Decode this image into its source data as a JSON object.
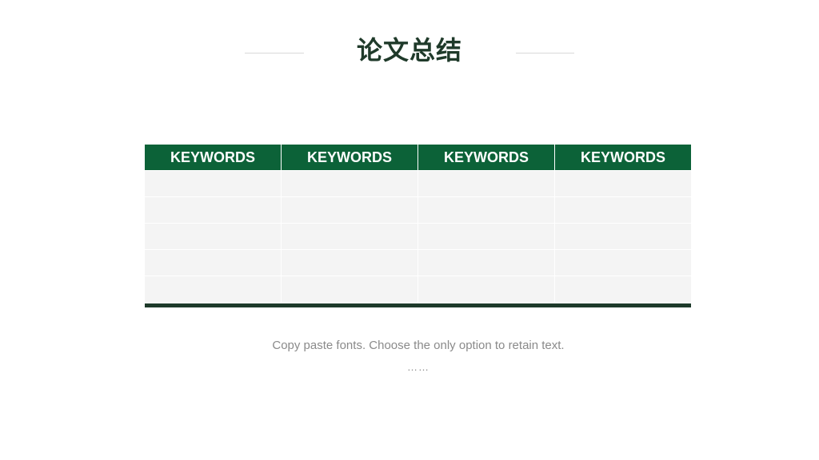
{
  "title": "论文总结",
  "table": {
    "headers": [
      "KEYWORDS",
      "KEYWORDS",
      "KEYWORDS",
      "KEYWORDS"
    ],
    "rows": [
      [
        "",
        "",
        "",
        ""
      ],
      [
        "",
        "",
        "",
        ""
      ],
      [
        "",
        "",
        "",
        ""
      ],
      [
        "",
        "",
        "",
        ""
      ],
      [
        "",
        "",
        "",
        ""
      ]
    ]
  },
  "caption": "Copy paste fonts. Choose the only option to retain text.",
  "ellipsis": "……",
  "colors": {
    "header_bg": "#0c6238",
    "bottom_bar": "#1e3a2a",
    "row_bg": "#f4f4f4",
    "title": "#1f3a2a"
  }
}
